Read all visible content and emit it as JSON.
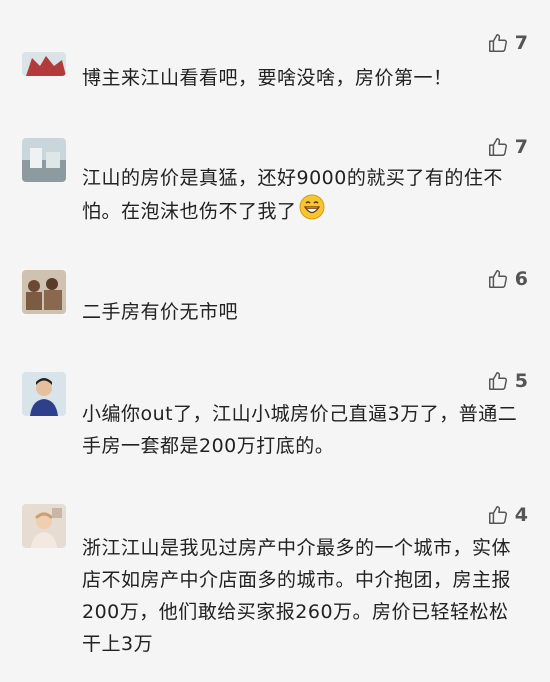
{
  "comments": [
    {
      "likes": "7",
      "text": "博主来江山看看吧，要啥没啥，房价第一！"
    },
    {
      "likes": "7",
      "text": "江山的房价是真猛，还好9000的就买了有的住不怕。在泡沫也伤不了我了",
      "emoji": "grinning-face"
    },
    {
      "likes": "6",
      "text": "二手房有价无市吧"
    },
    {
      "likes": "5",
      "text": "小编你out了，江山小城房价己直逼3万了，普通二手房一套都是200万打底的。"
    },
    {
      "likes": "4",
      "text": "浙江江山是我见过房产中介最多的一个城市，实体店不如房产中介店面多的城市。中介抱团，房主报200万，他们敢给买家报260万。房价已轻轻松松干上3万"
    }
  ]
}
